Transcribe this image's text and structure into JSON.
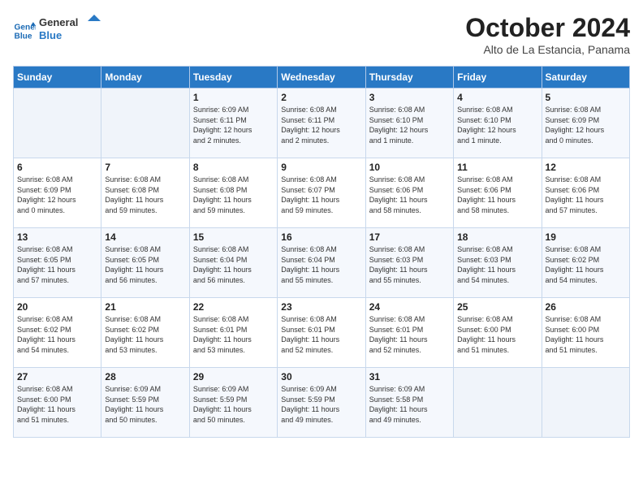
{
  "logo": {
    "line1": "General",
    "line2": "Blue"
  },
  "title": "October 2024",
  "subtitle": "Alto de La Estancia, Panama",
  "weekdays": [
    "Sunday",
    "Monday",
    "Tuesday",
    "Wednesday",
    "Thursday",
    "Friday",
    "Saturday"
  ],
  "weeks": [
    [
      {
        "day": "",
        "content": ""
      },
      {
        "day": "",
        "content": ""
      },
      {
        "day": "1",
        "content": "Sunrise: 6:09 AM\nSunset: 6:11 PM\nDaylight: 12 hours\nand 2 minutes."
      },
      {
        "day": "2",
        "content": "Sunrise: 6:08 AM\nSunset: 6:11 PM\nDaylight: 12 hours\nand 2 minutes."
      },
      {
        "day": "3",
        "content": "Sunrise: 6:08 AM\nSunset: 6:10 PM\nDaylight: 12 hours\nand 1 minute."
      },
      {
        "day": "4",
        "content": "Sunrise: 6:08 AM\nSunset: 6:10 PM\nDaylight: 12 hours\nand 1 minute."
      },
      {
        "day": "5",
        "content": "Sunrise: 6:08 AM\nSunset: 6:09 PM\nDaylight: 12 hours\nand 0 minutes."
      }
    ],
    [
      {
        "day": "6",
        "content": "Sunrise: 6:08 AM\nSunset: 6:09 PM\nDaylight: 12 hours\nand 0 minutes."
      },
      {
        "day": "7",
        "content": "Sunrise: 6:08 AM\nSunset: 6:08 PM\nDaylight: 11 hours\nand 59 minutes."
      },
      {
        "day": "8",
        "content": "Sunrise: 6:08 AM\nSunset: 6:08 PM\nDaylight: 11 hours\nand 59 minutes."
      },
      {
        "day": "9",
        "content": "Sunrise: 6:08 AM\nSunset: 6:07 PM\nDaylight: 11 hours\nand 59 minutes."
      },
      {
        "day": "10",
        "content": "Sunrise: 6:08 AM\nSunset: 6:06 PM\nDaylight: 11 hours\nand 58 minutes."
      },
      {
        "day": "11",
        "content": "Sunrise: 6:08 AM\nSunset: 6:06 PM\nDaylight: 11 hours\nand 58 minutes."
      },
      {
        "day": "12",
        "content": "Sunrise: 6:08 AM\nSunset: 6:06 PM\nDaylight: 11 hours\nand 57 minutes."
      }
    ],
    [
      {
        "day": "13",
        "content": "Sunrise: 6:08 AM\nSunset: 6:05 PM\nDaylight: 11 hours\nand 57 minutes."
      },
      {
        "day": "14",
        "content": "Sunrise: 6:08 AM\nSunset: 6:05 PM\nDaylight: 11 hours\nand 56 minutes."
      },
      {
        "day": "15",
        "content": "Sunrise: 6:08 AM\nSunset: 6:04 PM\nDaylight: 11 hours\nand 56 minutes."
      },
      {
        "day": "16",
        "content": "Sunrise: 6:08 AM\nSunset: 6:04 PM\nDaylight: 11 hours\nand 55 minutes."
      },
      {
        "day": "17",
        "content": "Sunrise: 6:08 AM\nSunset: 6:03 PM\nDaylight: 11 hours\nand 55 minutes."
      },
      {
        "day": "18",
        "content": "Sunrise: 6:08 AM\nSunset: 6:03 PM\nDaylight: 11 hours\nand 54 minutes."
      },
      {
        "day": "19",
        "content": "Sunrise: 6:08 AM\nSunset: 6:02 PM\nDaylight: 11 hours\nand 54 minutes."
      }
    ],
    [
      {
        "day": "20",
        "content": "Sunrise: 6:08 AM\nSunset: 6:02 PM\nDaylight: 11 hours\nand 54 minutes."
      },
      {
        "day": "21",
        "content": "Sunrise: 6:08 AM\nSunset: 6:02 PM\nDaylight: 11 hours\nand 53 minutes."
      },
      {
        "day": "22",
        "content": "Sunrise: 6:08 AM\nSunset: 6:01 PM\nDaylight: 11 hours\nand 53 minutes."
      },
      {
        "day": "23",
        "content": "Sunrise: 6:08 AM\nSunset: 6:01 PM\nDaylight: 11 hours\nand 52 minutes."
      },
      {
        "day": "24",
        "content": "Sunrise: 6:08 AM\nSunset: 6:01 PM\nDaylight: 11 hours\nand 52 minutes."
      },
      {
        "day": "25",
        "content": "Sunrise: 6:08 AM\nSunset: 6:00 PM\nDaylight: 11 hours\nand 51 minutes."
      },
      {
        "day": "26",
        "content": "Sunrise: 6:08 AM\nSunset: 6:00 PM\nDaylight: 11 hours\nand 51 minutes."
      }
    ],
    [
      {
        "day": "27",
        "content": "Sunrise: 6:08 AM\nSunset: 6:00 PM\nDaylight: 11 hours\nand 51 minutes."
      },
      {
        "day": "28",
        "content": "Sunrise: 6:09 AM\nSunset: 5:59 PM\nDaylight: 11 hours\nand 50 minutes."
      },
      {
        "day": "29",
        "content": "Sunrise: 6:09 AM\nSunset: 5:59 PM\nDaylight: 11 hours\nand 50 minutes."
      },
      {
        "day": "30",
        "content": "Sunrise: 6:09 AM\nSunset: 5:59 PM\nDaylight: 11 hours\nand 49 minutes."
      },
      {
        "day": "31",
        "content": "Sunrise: 6:09 AM\nSunset: 5:58 PM\nDaylight: 11 hours\nand 49 minutes."
      },
      {
        "day": "",
        "content": ""
      },
      {
        "day": "",
        "content": ""
      }
    ]
  ]
}
